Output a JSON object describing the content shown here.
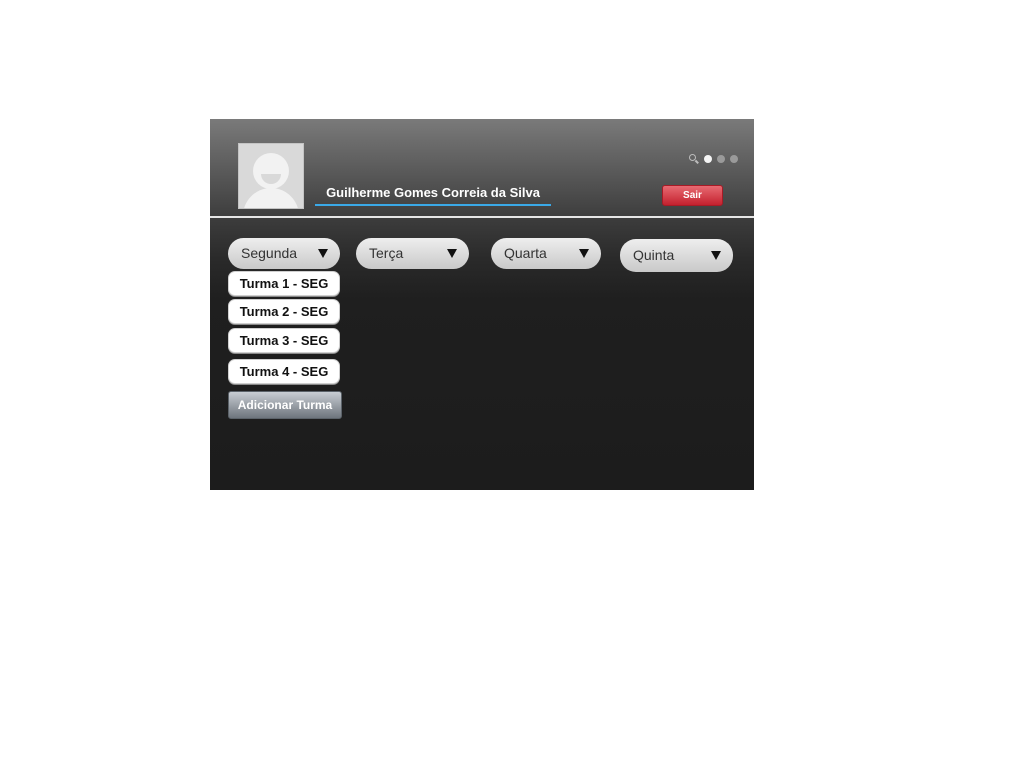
{
  "user": {
    "name": "Guilherme Gomes Correia da Silva"
  },
  "header": {
    "logout_label": "Sair",
    "icons": [
      "search-icon",
      "page-dot-active",
      "page-dot",
      "page-dot"
    ]
  },
  "days": [
    {
      "label": "Segunda"
    },
    {
      "label": "Terça"
    },
    {
      "label": "Quarta"
    },
    {
      "label": "Quinta"
    }
  ],
  "turmas": [
    {
      "label": "Turma 1 - SEG"
    },
    {
      "label": "Turma 2 - SEG"
    },
    {
      "label": "Turma 3 - SEG"
    },
    {
      "label": "Turma 4 - SEG"
    }
  ],
  "actions": {
    "add_label": "Adicionar Turma"
  },
  "colors": {
    "accent_underline": "#3aa9e8",
    "logout_button": "#d9424d",
    "add_button": "#8a9199",
    "background": "#1c1c1c"
  }
}
